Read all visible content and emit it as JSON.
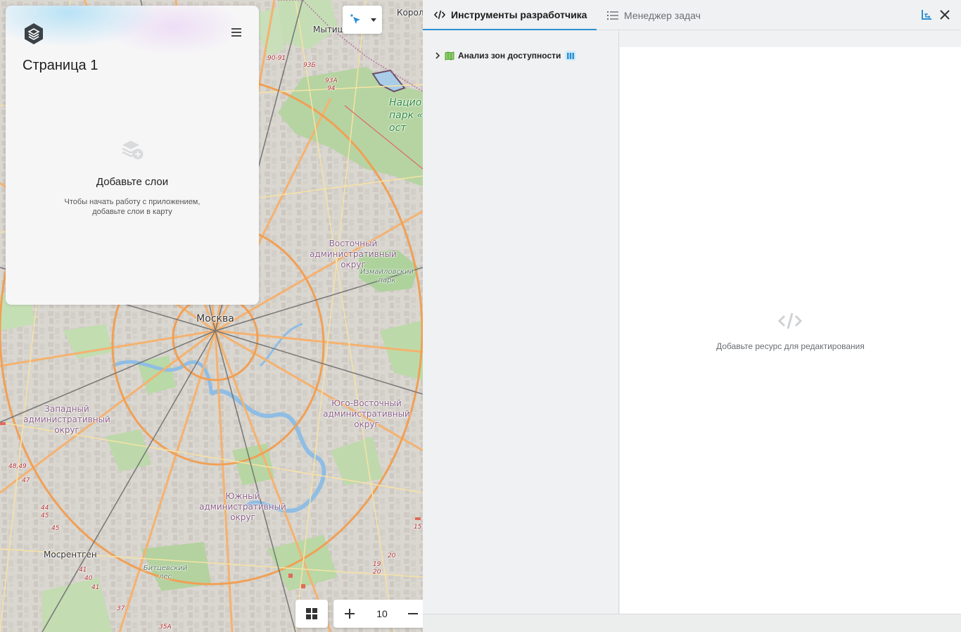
{
  "map": {
    "labels": {
      "moscow": "Москва",
      "mytishchi": "Мытищ",
      "korolev": "Корол",
      "national_park": "Нацио\nпарк «\nост",
      "east_okrug": "Восточный\nадминистративный\nокруг",
      "izmaylovsky": "Измайловский\nпарк",
      "west_okrug": "Западный\nадминистративный\nокруг",
      "southeast_okrug": "Юго-Восточный\nадминистративный\nокруг",
      "south_okrug": "Южный\nадминистративный\nокруг",
      "mosrentgen": "Мосрентген",
      "bittsevsky": "Битцевский\nлес",
      "moskva_river": "Москва"
    },
    "road_numbers": [
      "90-91",
      "93Б",
      "93А\n94",
      "48,49",
      "47",
      "44\n45",
      "45",
      "41",
      "40",
      "41",
      "37",
      "35А",
      "19\n20",
      "20",
      "15"
    ],
    "zoom_level": "10"
  },
  "side_panel": {
    "page_title": "Страница 1",
    "empty_title": "Добавьте слои",
    "empty_desc": "Чтобы начать работу с приложением, добавьте слои в карту"
  },
  "dev_panel": {
    "tabs": [
      {
        "label": "Инструменты разработчика",
        "icon": "code-icon",
        "active": true
      },
      {
        "label": "Менеджер задач",
        "icon": "list-icon",
        "active": false
      }
    ],
    "tree": [
      {
        "label": "Анализ зон доступности",
        "icon": "map-icon",
        "badge": "map-badge-icon"
      }
    ],
    "editor_empty_text": "Добавьте ресурс для редактирования"
  },
  "colors": {
    "accent": "#2b8fd3",
    "park_green": "#b7d6a6",
    "road_orange": "#f6b06e",
    "map_base": "#dcd8d2"
  }
}
